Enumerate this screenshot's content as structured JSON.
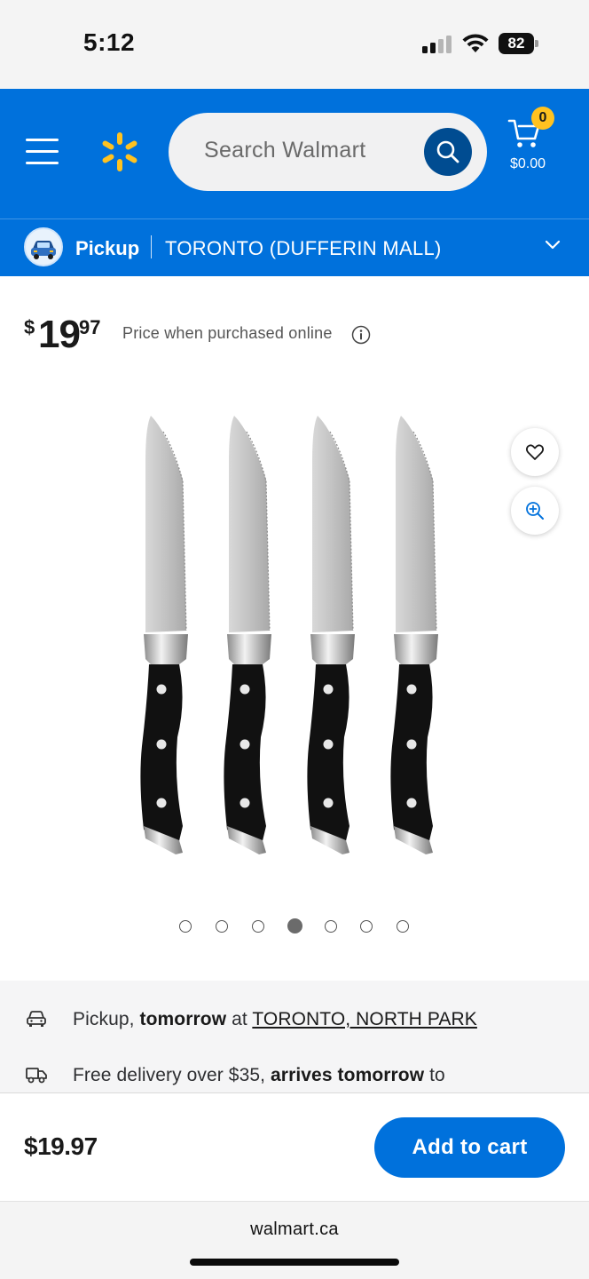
{
  "status_bar": {
    "time": "5:12",
    "battery": "82"
  },
  "header": {
    "search_placeholder": "Search Walmart",
    "cart_count": "0",
    "cart_total": "$0.00"
  },
  "pickup_bar": {
    "label": "Pickup",
    "store": "TORONTO (DUFFERIN MALL)"
  },
  "product": {
    "price_dollar": "$",
    "price_whole": "19",
    "price_cents": "97",
    "price_note": "Price when purchased online",
    "image_carousel": {
      "total": 7,
      "active_index": 3
    }
  },
  "fulfillment": {
    "pickup": {
      "prefix": "Pickup, ",
      "bold": "tomorrow",
      "middle": " at ",
      "link": "TORONTO, NORTH PARK"
    },
    "delivery": {
      "prefix": "Free delivery over $35, ",
      "bold": "arrives tomorrow",
      "suffix": " to"
    }
  },
  "cart_bar": {
    "price": "$19.97",
    "add_label": "Add to cart"
  },
  "browser": {
    "url": "walmart.ca"
  },
  "colors": {
    "brand_blue": "#0071dc",
    "spark_yellow": "#ffc220",
    "dark_blue": "#004c91"
  }
}
